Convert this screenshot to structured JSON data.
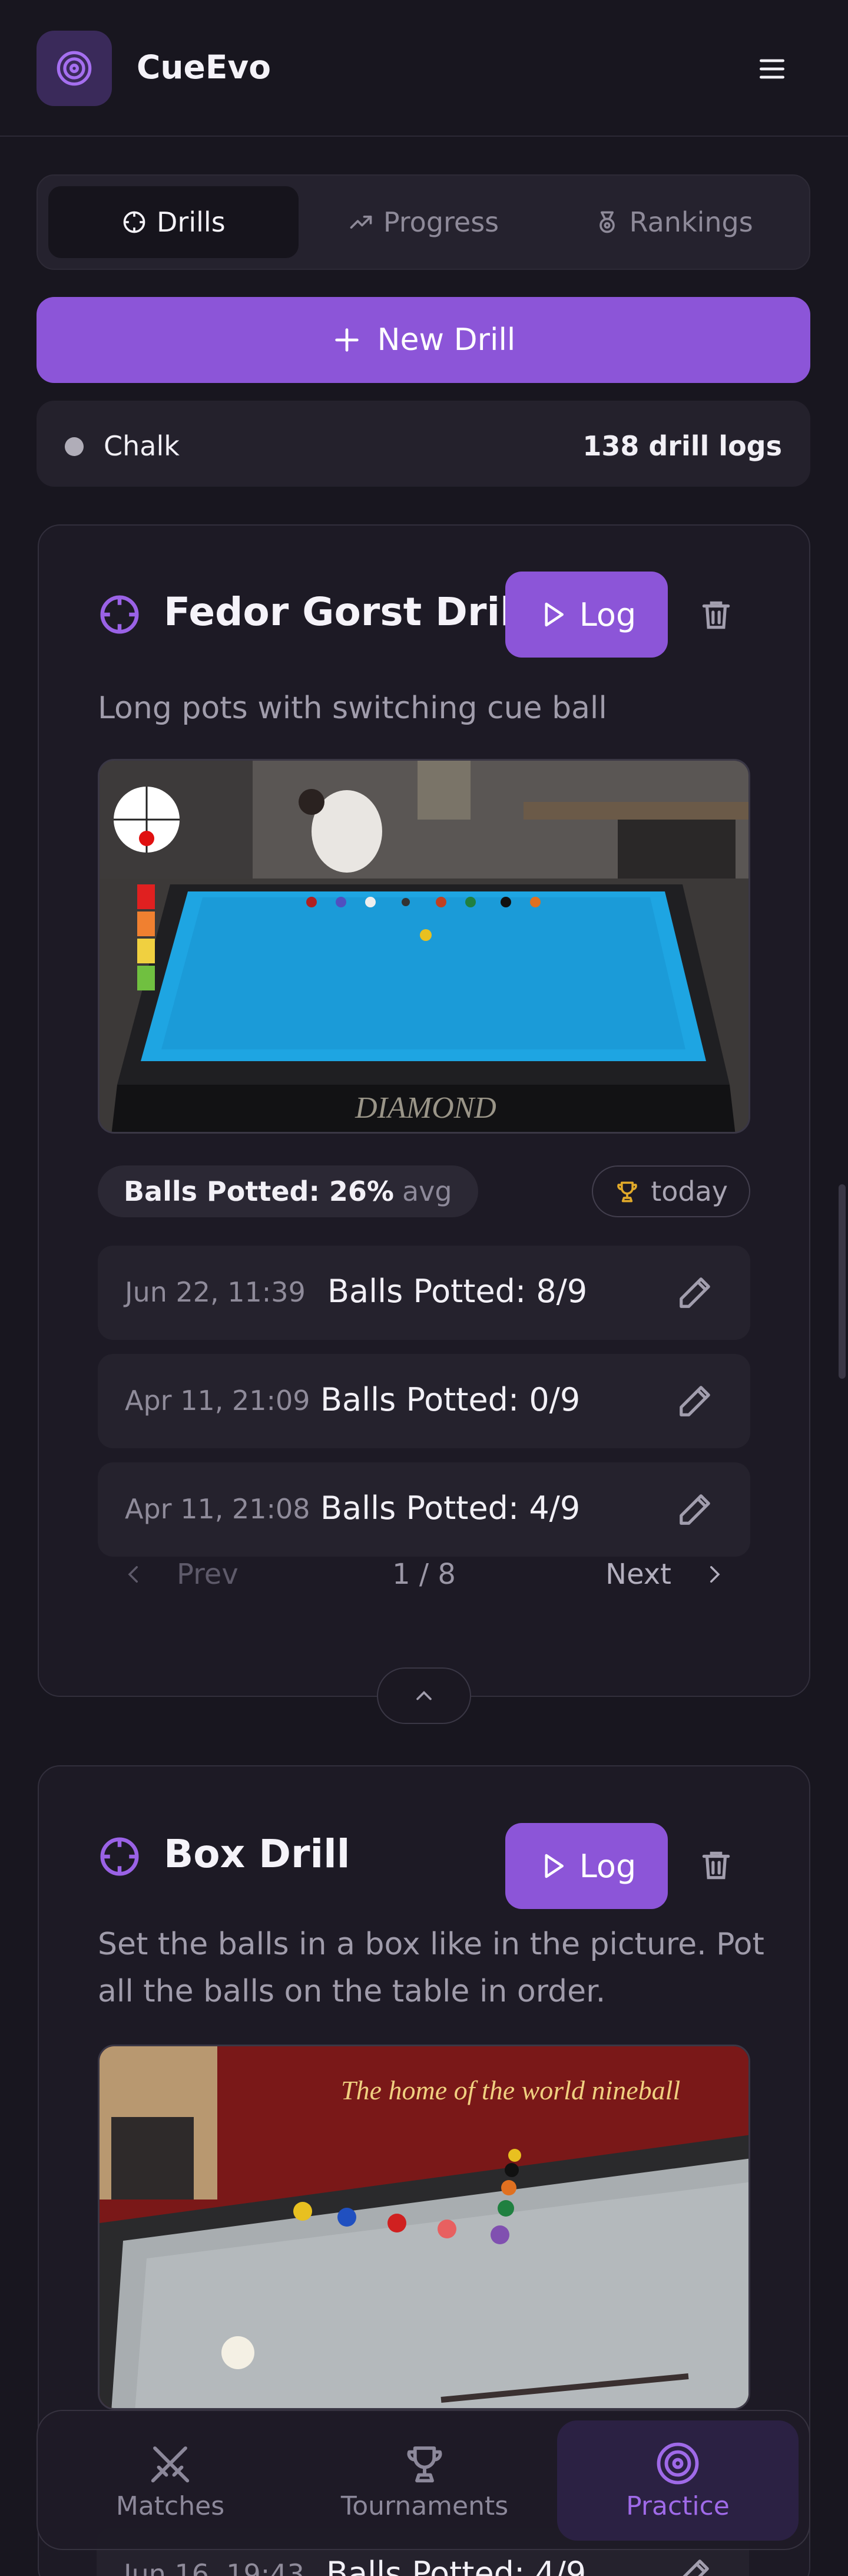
{
  "app": {
    "title": "CueEvo",
    "logo_icon": "target-icon",
    "accent": "#8c55d8"
  },
  "tabs": [
    {
      "label": "Drills",
      "icon": "crosshair-icon",
      "active": true
    },
    {
      "label": "Progress",
      "icon": "trending-up-icon",
      "active": false
    },
    {
      "label": "Rankings",
      "icon": "medal-icon",
      "active": false
    }
  ],
  "new_drill_label": "New Drill",
  "chalk": {
    "label": "Chalk",
    "count": "138 drill logs"
  },
  "drills": [
    {
      "title": "Fedor Gorst Drill",
      "description": "Long pots with switching cue ball",
      "log_label": "Log",
      "stat": {
        "label": "Balls Potted: 26%",
        "suffix": "avg"
      },
      "best": "today",
      "logs": [
        {
          "date": "Jun 22, 11:39",
          "value": "Balls Potted: 8/9"
        },
        {
          "date": "Apr 11, 21:09",
          "value": "Balls Potted: 0/9"
        },
        {
          "date": "Apr 11, 21:08",
          "value": "Balls Potted: 4/9"
        }
      ],
      "pager": {
        "prev": "Prev",
        "page": "1 / 8",
        "next": "Next"
      }
    },
    {
      "title": "Box Drill",
      "description": "Set the balls in a box like in the picture. Pot all the balls on the table in order.",
      "log_label": "Log",
      "image_text": "The home of the world nineball",
      "peek_log": {
        "date": "Jun 16, 19:43",
        "value": "Balls Potted: 4/9"
      }
    }
  ],
  "bottom_nav": [
    {
      "label": "Matches",
      "icon": "swords-icon",
      "active": false
    },
    {
      "label": "Tournaments",
      "icon": "trophy-icon",
      "active": false
    },
    {
      "label": "Practice",
      "icon": "target-icon",
      "active": true
    }
  ],
  "image1_brand": "DIAMOND"
}
